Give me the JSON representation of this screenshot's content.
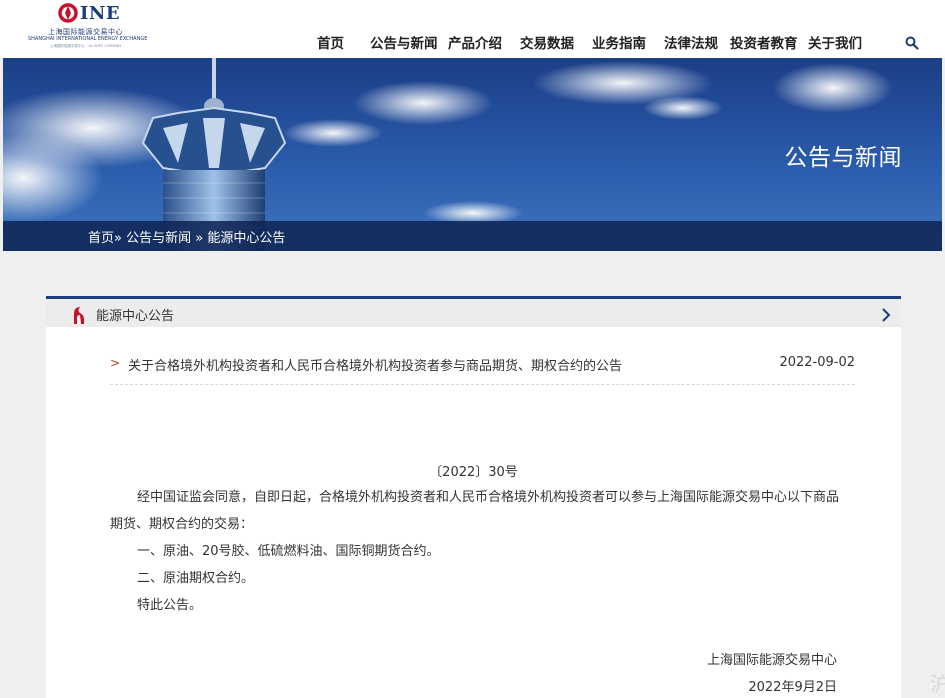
{
  "header": {
    "logo": {
      "brand": "INE",
      "cn_name": "上海国际能源交易中心",
      "en_name": "SHANGHAI INTERNATIONAL ENERGY EXCHANGE",
      "sub": "上海国际能源交易中心 · An SHFE COMPANY"
    },
    "nav": [
      {
        "label": "首页"
      },
      {
        "label": "公告与新闻"
      },
      {
        "label": "产品介绍"
      },
      {
        "label": "交易数据"
      },
      {
        "label": "业务指南"
      },
      {
        "label": "法律法规"
      },
      {
        "label": "投资者教育"
      },
      {
        "label": "关于我们"
      }
    ],
    "search_icon": "search-icon"
  },
  "banner": {
    "title": "公告与新闻",
    "breadcrumb": {
      "home": "首页»",
      "section": "公告与新闻",
      "sep": "»",
      "current": "能源中心公告"
    }
  },
  "panel": {
    "title": "能源中心公告",
    "notice": {
      "title": "关于合格境外机构投资者和人民币合格境外机构投资者参与商品期货、期权合约的公告",
      "date": "2022-09-02"
    },
    "doc_number": "〔2022〕30号",
    "paragraphs": [
      "经中国证监会同意，自即日起，合格境外机构投资者和人民币合格境外机构投资者可以参与上海国际能源交易中心以下商品期货、期权合约的交易：",
      "一、原油、20号胶、低硫燃料油、国际铜期货合约。",
      "二、原油期权合约。",
      "特此公告。"
    ],
    "signature_org": "上海国际能源交易中心",
    "signature_date": "2022年9月2日"
  },
  "edge_char": "沪",
  "colors": {
    "navy": "#1d3e7c",
    "accent_red": "#c0392b",
    "banner_blue": "#234d9a"
  }
}
